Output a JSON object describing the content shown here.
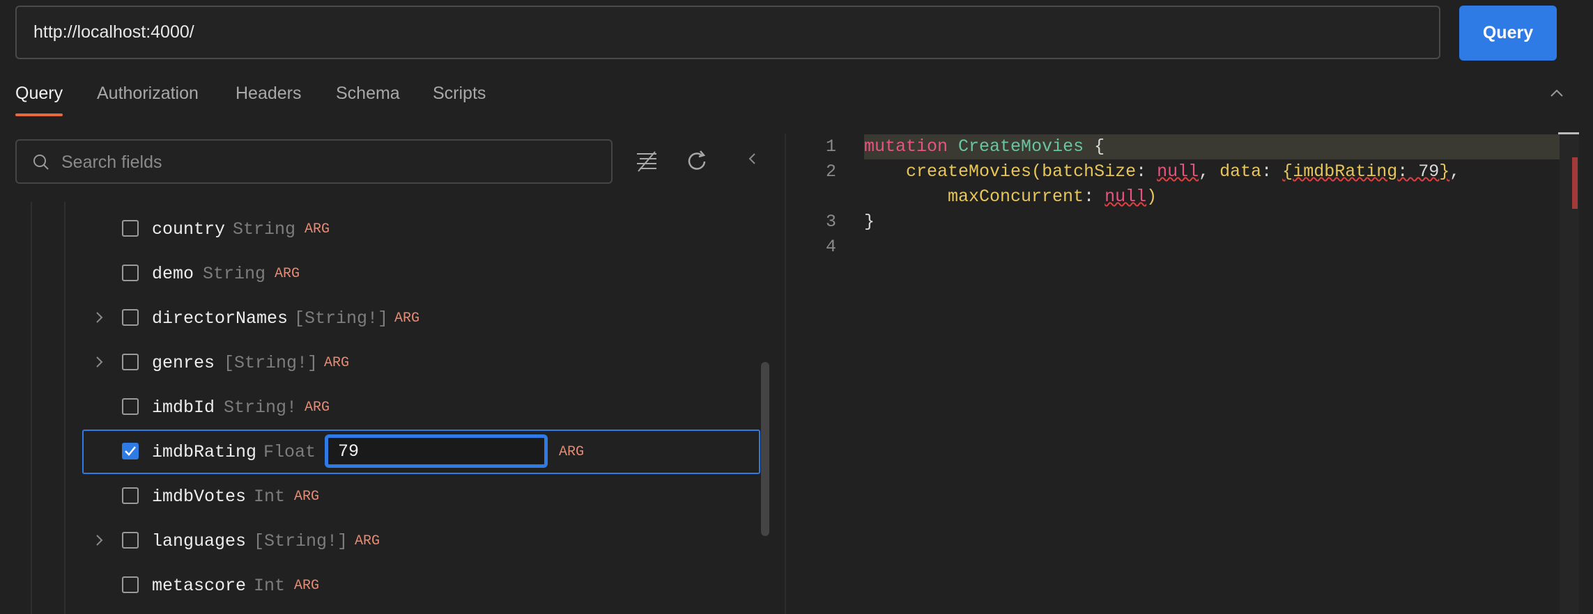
{
  "url_bar": {
    "value": "http://localhost:4000/",
    "button_label": "Query"
  },
  "tabs": [
    {
      "label": "Query",
      "active": true
    },
    {
      "label": "Authorization",
      "active": false
    },
    {
      "label": "Headers",
      "active": false
    },
    {
      "label": "Schema",
      "active": false
    },
    {
      "label": "Scripts",
      "active": false
    }
  ],
  "explorer": {
    "search_placeholder": "Search fields",
    "arg_badge": "ARG",
    "fields": [
      {
        "name": "country",
        "type": "String",
        "expandable": false,
        "checked": false
      },
      {
        "name": "demo",
        "type": "String",
        "expandable": false,
        "checked": false
      },
      {
        "name": "directorNames",
        "type": "[String!]",
        "expandable": true,
        "checked": false
      },
      {
        "name": "genres",
        "type": "[String!]",
        "expandable": true,
        "checked": false
      },
      {
        "name": "imdbId",
        "type": "String!",
        "expandable": false,
        "checked": false
      },
      {
        "name": "imdbRating",
        "type": "Float",
        "expandable": false,
        "checked": true,
        "value": "79"
      },
      {
        "name": "imdbVotes",
        "type": "Int",
        "expandable": false,
        "checked": false
      },
      {
        "name": "languages",
        "type": "[String!]",
        "expandable": true,
        "checked": false
      },
      {
        "name": "metascore",
        "type": "Int",
        "expandable": false,
        "checked": false
      }
    ]
  },
  "editor": {
    "line_numbers": [
      "1",
      "2",
      "3",
      "4"
    ],
    "tokens": {
      "mutation": "mutation",
      "op_name": "CreateMovies",
      "open_brace": " {",
      "indent2": "    ",
      "fn_name": "createMovies",
      "paren_open": "(",
      "arg1": "batchSize",
      "colon": ": ",
      "null": "null",
      "comma": ", ",
      "arg2": "data",
      "obj_open": "{",
      "obj_key": "imdbRating",
      "obj_val": ": 79",
      "obj_close": "}",
      "comma2": ",",
      "indent3": "        ",
      "arg3": "maxConcurrent",
      "paren_close": ")",
      "close_brace": "}"
    }
  }
}
